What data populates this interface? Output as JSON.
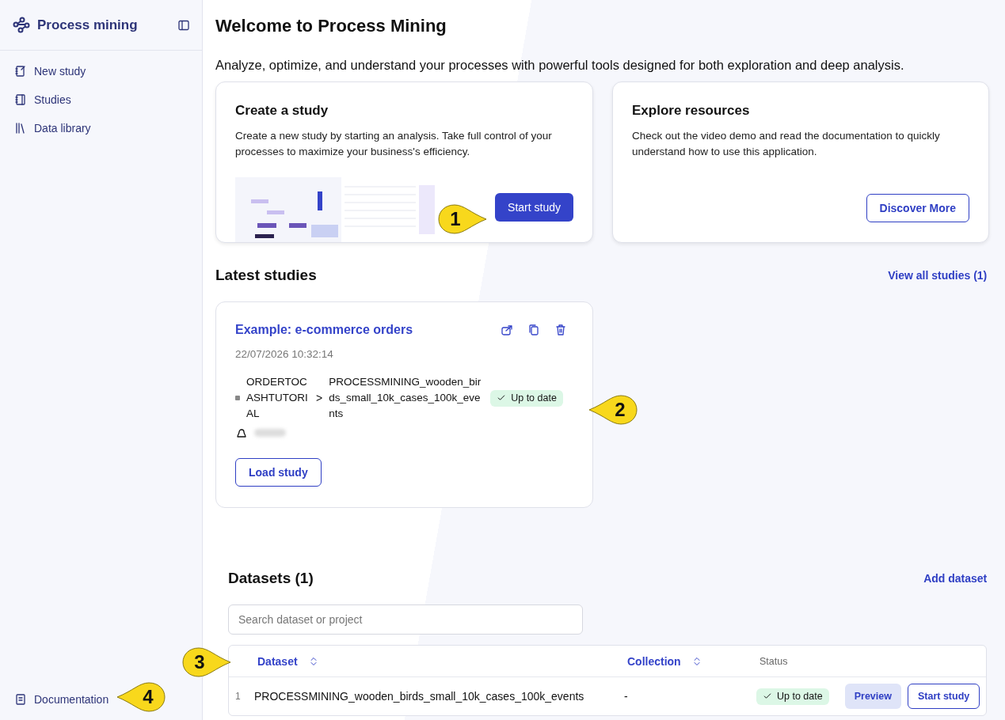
{
  "sidebar": {
    "app_name": "Process mining",
    "items": [
      {
        "label": "New study"
      },
      {
        "label": "Studies"
      },
      {
        "label": "Data library"
      }
    ],
    "footer_item": {
      "label": "Documentation"
    }
  },
  "main": {
    "title": "Welcome to Process Mining",
    "subtitle": "Analyze, optimize, and understand your processes with powerful tools designed for both exploration and deep analysis.",
    "cards": [
      {
        "kind": "create",
        "title": "Create a study",
        "text": "Create a new study by starting an analysis. Take full control of your processes to maximize your business's efficiency.",
        "button": "Start study"
      },
      {
        "kind": "explore",
        "title": "Explore resources",
        "text": "Check out the video demo and read the documentation to quickly understand how to use this application.",
        "button": "Discover More"
      }
    ],
    "latest": {
      "heading": "Latest studies",
      "link": "View all studies (1)",
      "study": {
        "title": "Example: e-commerce orders",
        "date": "22/07/2026 10:32:14",
        "collection": "ORDERTOCASHTUTORIAL",
        "separator": ">",
        "dataset": "PROCESSMINING_wooden_birds_small_10k_cases_100k_events",
        "status": "Up to date",
        "button": "Load study"
      }
    },
    "datasets": {
      "heading": "Datasets (1)",
      "link": "Add dataset",
      "search": {
        "placeholder": "Search dataset or project"
      },
      "columns": [
        {
          "label": "Dataset",
          "sortable": true
        },
        {
          "label": "Collection",
          "sortable": true
        },
        {
          "label": "Status",
          "sortable": false
        }
      ],
      "rows": [
        {
          "index": "1",
          "dataset": "PROCESSMINING_wooden_birds_small_10k_cases_100k_events",
          "collection": "-",
          "status": "Up to date",
          "actions": [
            "Preview",
            "Start study"
          ]
        }
      ]
    }
  },
  "callouts": [
    {
      "number": "1"
    },
    {
      "number": "2"
    },
    {
      "number": "3"
    },
    {
      "number": "4"
    }
  ]
}
